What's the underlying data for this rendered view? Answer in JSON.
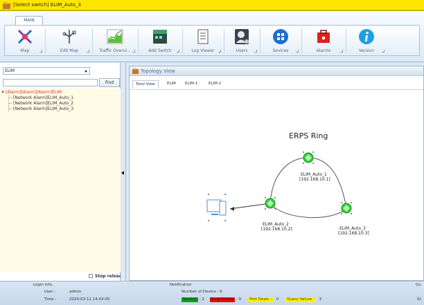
{
  "window": {
    "title": "[Select switch] ELIM_Auto_3"
  },
  "ribbon": {
    "tab_main": "MAIN",
    "tools": [
      {
        "label": "Map",
        "icon": "map-icon"
      },
      {
        "label": "Edit Map",
        "icon": "edit-map-icon"
      },
      {
        "label": "Traffic Overvi...",
        "icon": "traffic-chart-icon"
      },
      {
        "label": "Add Switch",
        "icon": "add-switch-icon"
      },
      {
        "label": "Log Viewer",
        "icon": "log-viewer-icon"
      },
      {
        "label": "Users",
        "icon": "users-icon"
      },
      {
        "label": "Sevices",
        "icon": "services-icon"
      },
      {
        "label": "Alarms",
        "icon": "alarms-icon"
      },
      {
        "label": "Version",
        "icon": "version-info-icon"
      }
    ]
  },
  "left": {
    "combo_value": "ELIM",
    "search_placeholder": "",
    "find_label": "Find",
    "tree_root": "[Alarm][Alarm][Alarm]ELIM",
    "tree_children": [
      "[Network Alarm]ELIM_Auto_1",
      "[Network Alarm]ELIM_Auto_2",
      "[Network Alarm]ELIM_Auto_3"
    ],
    "stop_reload": "Stop reload"
  },
  "topology": {
    "title": "Topology View",
    "tabs": [
      "Total View",
      "ELIM",
      "ELIM-1",
      "ELIM-2"
    ],
    "ring_label": "ERPS Ring",
    "nodes": [
      {
        "name": "ELIM_Auto_1",
        "ip": "[192.168.10.1]"
      },
      {
        "name": "ELIM_Auto_2",
        "ip": "[192.168.10.2]"
      },
      {
        "name": "ELIM_Auto_3",
        "ip": "[192.168.10.3]"
      }
    ]
  },
  "status": {
    "login_heading": "Login info.",
    "user_label": "User :",
    "user_value": "admin",
    "time_label": "Time :",
    "time_value": "2020-03-11 14:43:05",
    "notification_heading": "Notification",
    "device_count_label": "Number of Device : 9",
    "normal_label": "Normal",
    "normal_value": ": 2",
    "ring_failure_label": "Ring Failure",
    "ring_failure_value": ": 9",
    "port_down_label": "Port Down :",
    "port_down_value": "0",
    "query_failure_label": "Query failure :",
    "query_failure_value": "3",
    "right_clip_1": "Qu",
    "right_clip_2": "St"
  },
  "colors": {
    "titlebar": "#ffe600",
    "normal": "#1a9a2a",
    "ring_failure": "#e01010",
    "warning": "#fff200",
    "alarm_text": "#e0302a",
    "node_green": "#2fd23a"
  }
}
